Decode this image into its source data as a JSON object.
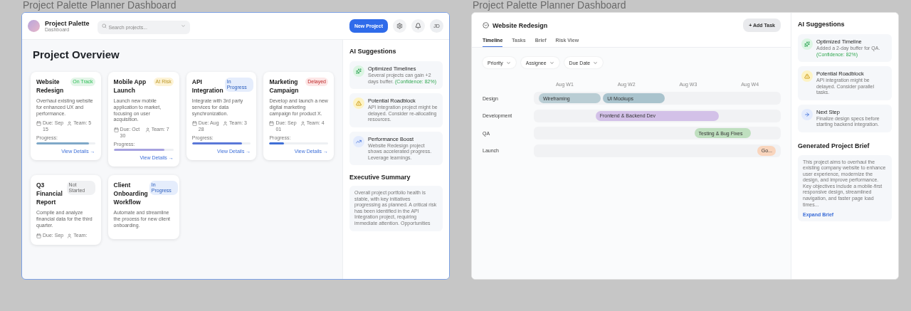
{
  "left": {
    "caption": "Project Palette Planner Dashboard",
    "brand": {
      "name": "Project Palette",
      "subtitle": "Dashboard"
    },
    "search": {
      "placeholder": "Search projects..."
    },
    "new_button": "New Project",
    "user_initials": "JD",
    "overview_title": "Project Overview",
    "projects": [
      {
        "title": "Website Redesign",
        "status": {
          "text": "On Track",
          "color": "#e3f5e8"
        },
        "description": "Overhaul existing website for enhanced UX and performance.",
        "due": "Due: Sep 15",
        "team": "Team: 5",
        "progress": {
          "label": "Progress:",
          "level": 0.9,
          "color": "#7fa8c8"
        },
        "link": "View Details →"
      },
      {
        "title": "Mobile App Launch",
        "status": {
          "text": "At Risk",
          "color": "#fdf3d6"
        },
        "description": "Launch new mobile application to market, focusing on user acquisition.",
        "due": "Due: Oct 30",
        "team": "Team: 7",
        "progress": {
          "label": "Progress:",
          "level": 0.85,
          "color": "#a7a3e0"
        },
        "link": "View Details →"
      },
      {
        "title": "API Integration",
        "status": {
          "text": "In Progress",
          "color": "#e5edfc"
        },
        "description": "Integrate with 3rd party services for data synchronization.",
        "due": "Due: Aug 28",
        "team": "Team: 3",
        "progress": {
          "label": "Progress:",
          "level": 0.85,
          "color": "#5b78d8"
        },
        "link": "View Details →"
      },
      {
        "title": "Marketing Campaign",
        "status": {
          "text": "Delayed",
          "color": "#fde6e6"
        },
        "description": "Develop and launch a new digital marketing campaign for product X.",
        "due": "Due: Sep 01",
        "team": "Team: 4",
        "progress": {
          "label": "Progress:",
          "level": 0.25,
          "color": "#3f6fd6"
        },
        "link": "View Details →"
      },
      {
        "title": "Q3 Financial Report",
        "status": {
          "text": "Not Started",
          "color": "#f0f1f3"
        },
        "description": "Compile and analyze financial data for the third quarter.",
        "due": "Due: Sep",
        "team": "Team:"
      },
      {
        "title": "Client Onboarding Workflow",
        "status": {
          "text": "In Progress",
          "color": "#e5edfc"
        },
        "description": "Automate and streamline the process for new client onboarding."
      }
    ],
    "suggestions_title": "AI Suggestions",
    "suggestions": [
      {
        "kind": "sparkle",
        "title": "Optimized Timelines",
        "text": "Several projects can gain +2 days buffer.",
        "confidence": "(Confidence: 82%)"
      },
      {
        "kind": "warning",
        "title": "Potential Roadblock",
        "text": "API integration project might be delayed. Consider re-allocating resources."
      },
      {
        "kind": "trend",
        "title": "Performance Boost",
        "text": "Website Redesign project shows accelerated progress. Leverage learnings."
      }
    ],
    "summary_title": "Executive Summary",
    "summary": "Overall project portfolio health is stable, with key initiatives progressing as planned. A critical risk has been identified in the API Integration project, requiring immediate attention. Opportunities"
  },
  "right": {
    "caption": "Project Palette Planner Dashboard",
    "title": "Website Redesign",
    "add_button": "+ Add Task",
    "tabs": [
      {
        "label": "Timeline",
        "selected": true
      },
      {
        "label": "Tasks",
        "selected": false
      },
      {
        "label": "Brief",
        "selected": false
      },
      {
        "label": "Risk View",
        "selected": false
      }
    ],
    "filters": [
      "Priority",
      "Assignee",
      "Due Date"
    ],
    "weeks": [
      "Aug W1",
      "Aug W2",
      "Aug W3",
      "Aug W4"
    ],
    "rows": [
      {
        "label": "Design",
        "bars": [
          {
            "label": "Wireframing",
            "color": "#b9cdd4"
          },
          {
            "label": "UI Mockups",
            "color": "#a9c3cd"
          }
        ]
      },
      {
        "label": "Development",
        "bars": [
          {
            "label": "Frontend & Backend Dev",
            "color": "#d3c1e8"
          }
        ]
      },
      {
        "label": "QA",
        "bars": [
          {
            "label": "Testing & Bug Fixes",
            "color": "#bfdfbf"
          }
        ]
      },
      {
        "label": "Launch",
        "bars": [
          {
            "label": "Go...",
            "color": "#f9d5bd"
          }
        ]
      }
    ],
    "suggestions_title": "AI Suggestions",
    "suggestions": [
      {
        "kind": "sparkle",
        "title": "Optimized Timeline",
        "text": "Added a 2-day buffer for QA.",
        "confidence": "(Confidence: 82%)"
      },
      {
        "kind": "warning",
        "title": "Potential Roadblock",
        "text": "API integration might be delayed. Consider parallel tasks."
      },
      {
        "kind": "arrow",
        "title": "Next Step",
        "text": "Finalize design specs before starting backend integration."
      }
    ],
    "brief_title": "Generated Project Brief",
    "brief": "This project aims to overhaul the existing company website to enhance user experience, modernize the design, and improve performance. Key objectives include a mobile-first responsive design, streamlined navigation, and faster page load times...",
    "brief_link": "Expand Brief"
  }
}
